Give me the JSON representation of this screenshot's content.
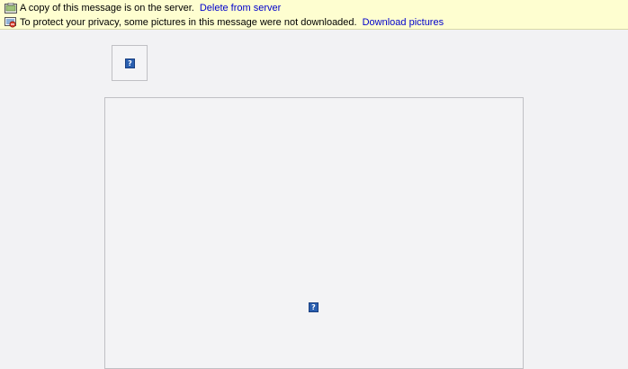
{
  "notice_bar": {
    "server_copy": {
      "icon": "mail-server-icon",
      "text": "A copy of this message is on the server.",
      "link_label": "Delete from server"
    },
    "privacy": {
      "icon": "blocked-images-icon",
      "text": "To protect your privacy, some pictures in this message were not downloaded.",
      "link_label": "Download pictures"
    }
  },
  "placeholders": {
    "broken_image_glyph": "?"
  },
  "colors": {
    "notice_background": "#fefed0",
    "link": "#0000cc",
    "body_background": "#f2f2f4",
    "broken_image_icon": "#2a5fb0"
  }
}
